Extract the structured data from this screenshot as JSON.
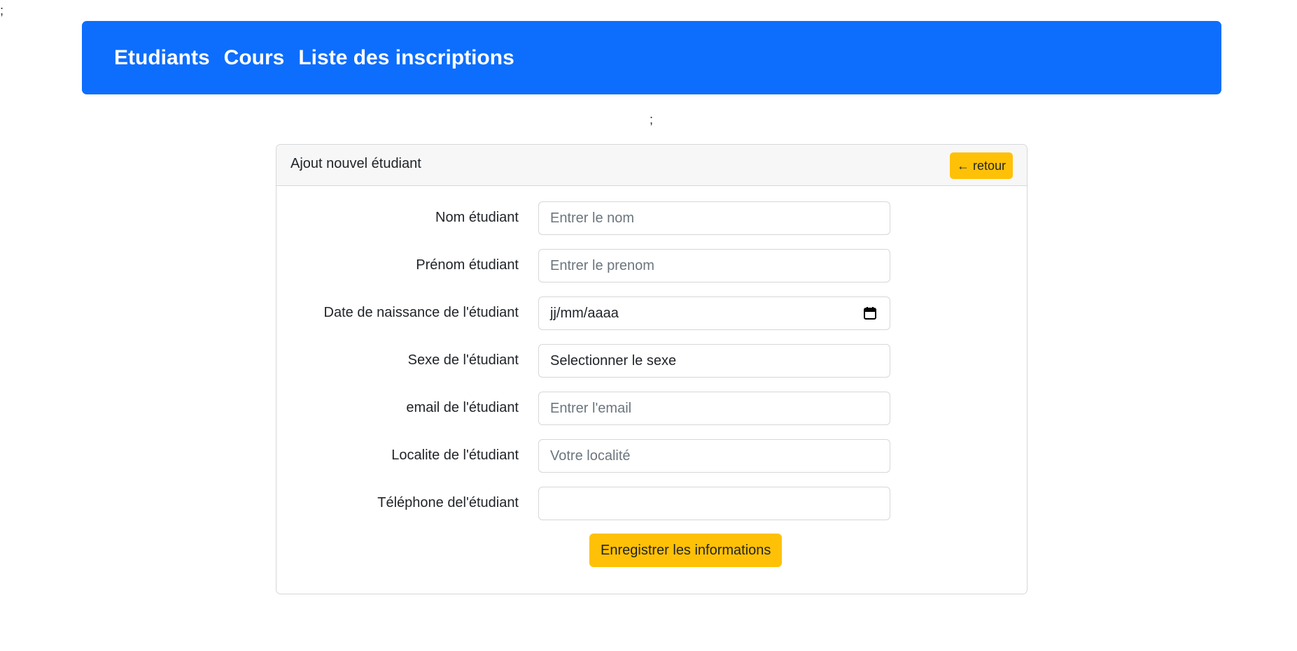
{
  "stray_text_top": ";",
  "stray_text_mid": ";",
  "navbar": {
    "links": [
      {
        "label": "Etudiants"
      },
      {
        "label": "Cours"
      },
      {
        "label": "Liste des inscriptions"
      }
    ],
    "color": "#0d6efd"
  },
  "card": {
    "title": "Ajout nouvel étudiant",
    "back_button": "← retour"
  },
  "form": {
    "nom": {
      "label": "Nom étudiant",
      "placeholder": "Entrer le nom",
      "value": ""
    },
    "prenom": {
      "label": "Prénom étudiant",
      "placeholder": "Entrer le prenom",
      "value": ""
    },
    "date_naissance": {
      "label": "Date de naissance de l'étudiant",
      "value": "jj/mm/aaaa",
      "icon": "calendar-icon"
    },
    "sexe": {
      "label": "Sexe de l'étudiant",
      "selected": "Selectionner le sexe"
    },
    "email": {
      "label": "email de l'étudiant",
      "placeholder": "Entrer l'email",
      "value": ""
    },
    "localite": {
      "label": "Localite de l'étudiant",
      "placeholder": "Votre localité",
      "value": ""
    },
    "telephone": {
      "label": "Téléphone del'étudiant",
      "placeholder": "",
      "value": ""
    },
    "submit_label": "Enregistrer les informations"
  },
  "colors": {
    "primary": "#0d6efd",
    "warning": "#ffc107"
  }
}
